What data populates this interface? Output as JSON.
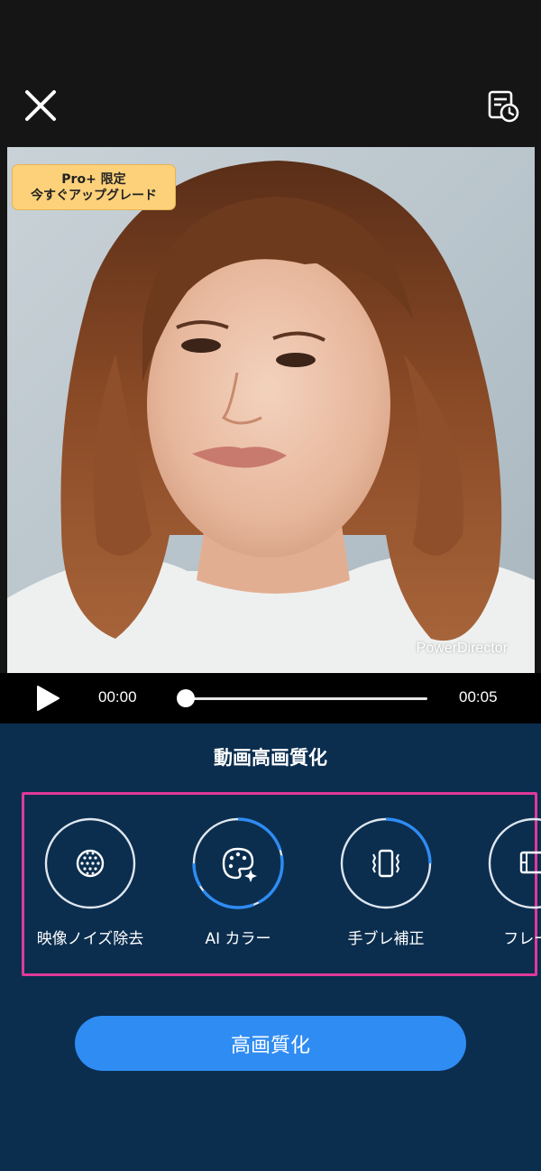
{
  "header": {
    "close_icon": "close-icon",
    "history_icon": "history-clock-icon"
  },
  "preview": {
    "badge_line1": "Pro+ 限定",
    "badge_line2": "今すぐアップグレード",
    "watermark": "PowerDirector"
  },
  "playback": {
    "current_time": "00:00",
    "total_time": "00:05",
    "progress": 0
  },
  "panel": {
    "title": "動画高画質化",
    "tools": [
      {
        "label": "映像ノイズ除去",
        "icon": "noise-dots-icon",
        "state": "inactive"
      },
      {
        "label": "AI カラー",
        "icon": "palette-sparkle-icon",
        "state": "active"
      },
      {
        "label": "手ブレ補正",
        "icon": "phone-shake-icon",
        "state": "active"
      },
      {
        "label": "フレーム",
        "icon": "film-frame-icon",
        "state": "inactive"
      }
    ],
    "cta_label": "高画質化",
    "colors": {
      "panel_bg": "#0b2e4f",
      "accent_blue": "#2f8cf3",
      "badge_yellow": "#fcd17a",
      "highlight_pink": "#e1399a"
    }
  }
}
